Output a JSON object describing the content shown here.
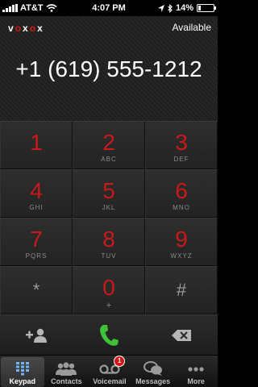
{
  "status_bar": {
    "carrier": "AT&T",
    "time": "4:07 PM",
    "battery_text": "14%",
    "battery_level": 0.14,
    "icons": [
      "signal-icon",
      "wifi-icon",
      "location-icon",
      "bluetooth-icon",
      "battery-icon"
    ]
  },
  "header": {
    "logo": {
      "prefix": "v",
      "accent": "o",
      "mid": "x",
      "accent2": "o",
      "suffix": "x"
    },
    "availability": "Available",
    "dialed_number": "+1 (619) 555-1212"
  },
  "keypad": [
    {
      "digit": "1",
      "letters": ""
    },
    {
      "digit": "2",
      "letters": "ABC"
    },
    {
      "digit": "3",
      "letters": "DEF"
    },
    {
      "digit": "4",
      "letters": "GHI"
    },
    {
      "digit": "5",
      "letters": "JKL"
    },
    {
      "digit": "6",
      "letters": "MNO"
    },
    {
      "digit": "7",
      "letters": "PQRS"
    },
    {
      "digit": "8",
      "letters": "TUV"
    },
    {
      "digit": "9",
      "letters": "WXYZ"
    },
    {
      "digit": "*",
      "letters": ""
    },
    {
      "digit": "0",
      "letters": "+"
    },
    {
      "digit": "#",
      "letters": ""
    }
  ],
  "actions": {
    "add_contact_icon": "add-contact-icon",
    "call_icon": "phone-call-icon",
    "backspace_icon": "backspace-icon"
  },
  "tabs": [
    {
      "label": "Keypad",
      "icon": "keypad-icon",
      "active": true
    },
    {
      "label": "Contacts",
      "icon": "contacts-icon",
      "active": false
    },
    {
      "label": "Voicemail",
      "icon": "voicemail-icon",
      "active": false,
      "badge": "1"
    },
    {
      "label": "Messages",
      "icon": "messages-icon",
      "active": false
    },
    {
      "label": "More",
      "icon": "more-icon",
      "active": false
    }
  ],
  "colors": {
    "accent_red": "#c8191b",
    "call_green": "#3fc23a",
    "badge_red": "#d01818"
  }
}
